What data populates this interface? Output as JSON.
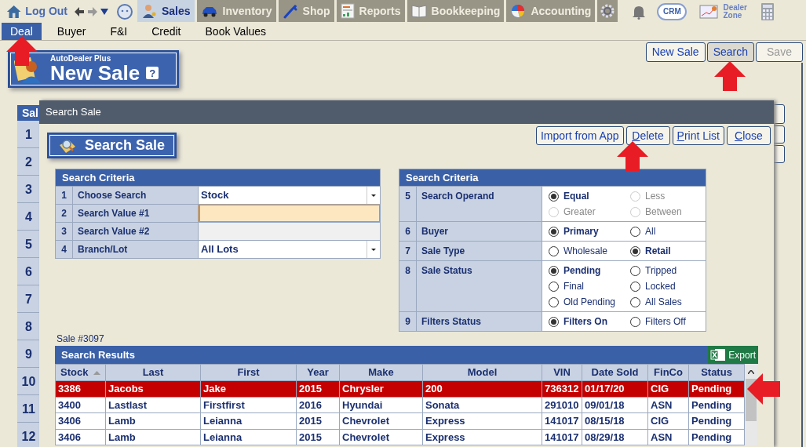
{
  "top_bar": {
    "logout": "Log Out",
    "tabs": [
      {
        "label": "Sales",
        "selected": true
      },
      {
        "label": "Inventory",
        "selected": false
      },
      {
        "label": "Shop",
        "selected": false
      },
      {
        "label": "Reports",
        "selected": false
      },
      {
        "label": "Bookkeeping",
        "selected": false
      },
      {
        "label": "Accounting",
        "selected": false
      }
    ],
    "crm": "CRM",
    "dealer_zone": [
      "Dealer",
      "Zone"
    ]
  },
  "sub_tabs": [
    {
      "label": "Deal",
      "selected": true
    },
    {
      "label": "Buyer",
      "selected": false
    },
    {
      "label": "F&I",
      "selected": false
    },
    {
      "label": "Credit",
      "selected": false
    },
    {
      "label": "Book Values",
      "selected": false
    }
  ],
  "banner": {
    "brand": "AutoDealer Plus",
    "title": "New Sale",
    "help": "?"
  },
  "actions": [
    {
      "label": "New Sale",
      "pressed": false,
      "disabled": false
    },
    {
      "label": "Search",
      "pressed": true,
      "disabled": false
    },
    {
      "label": "Save",
      "pressed": false,
      "disabled": true
    }
  ],
  "background_list": {
    "header": "Sal",
    "rows": [
      "1",
      "2",
      "3",
      "4",
      "5",
      "6",
      "7",
      "8",
      "9",
      "10",
      "11",
      "12"
    ]
  },
  "dialog": {
    "title": "Search Sale",
    "banner": "Search Sale",
    "buttons": [
      {
        "label": "Import from App",
        "underline_first": false
      },
      {
        "label": "Delete",
        "underline_first": true
      },
      {
        "label": "Print List",
        "underline_first": true
      },
      {
        "label": "Close",
        "underline_first": true
      }
    ],
    "criteria_left": {
      "title": "Search Criteria",
      "rows": [
        {
          "number": "1",
          "label": "Choose Search",
          "kind": "select",
          "value": "Stock"
        },
        {
          "number": "2",
          "label": "Search Value #1",
          "kind": "input",
          "focused": true,
          "disabled": false
        },
        {
          "number": "3",
          "label": "Search Value #2",
          "kind": "input",
          "focused": false,
          "disabled": true
        },
        {
          "number": "4",
          "label": "Branch/Lot",
          "kind": "select",
          "value": "All Lots"
        }
      ]
    },
    "criteria_right": {
      "title": "Search Criteria",
      "rows": [
        {
          "number": "5",
          "label": "Search Operand",
          "options": [
            {
              "label": "Equal",
              "selected": true,
              "disabled": false
            },
            {
              "label": "Less",
              "selected": false,
              "disabled": true
            },
            {
              "label": "Greater",
              "selected": false,
              "disabled": true
            },
            {
              "label": "Between",
              "selected": false,
              "disabled": true
            }
          ]
        },
        {
          "number": "6",
          "label": "Buyer",
          "options": [
            {
              "label": "Primary",
              "selected": true,
              "disabled": false
            },
            {
              "label": "All",
              "selected": false,
              "disabled": false
            }
          ]
        },
        {
          "number": "7",
          "label": "Sale Type",
          "options": [
            {
              "label": "Wholesale",
              "selected": false,
              "disabled": false
            },
            {
              "label": "Retail",
              "selected": true,
              "disabled": false
            }
          ]
        },
        {
          "number": "8",
          "label": "Sale Status",
          "options": [
            {
              "label": "Pending",
              "selected": true,
              "disabled": false
            },
            {
              "label": "Tripped",
              "selected": false,
              "disabled": false
            },
            {
              "label": "Final",
              "selected": false,
              "disabled": false
            },
            {
              "label": "Locked",
              "selected": false,
              "disabled": false
            },
            {
              "label": "Old Pending",
              "selected": false,
              "disabled": false
            },
            {
              "label": "All Sales",
              "selected": false,
              "disabled": false
            }
          ]
        },
        {
          "number": "9",
          "label": "Filters Status",
          "options": [
            {
              "label": "Filters On",
              "selected": true,
              "disabled": false
            },
            {
              "label": "Filters Off",
              "selected": false,
              "disabled": false
            }
          ]
        }
      ]
    },
    "sale_number": "Sale #3097",
    "results": {
      "title": "Search Results",
      "export": "Export",
      "columns": [
        {
          "label": "Stock",
          "sorted": true
        },
        {
          "label": "Last",
          "sorted": false
        },
        {
          "label": "First",
          "sorted": false
        },
        {
          "label": "Year",
          "sorted": false
        },
        {
          "label": "Make",
          "sorted": false
        },
        {
          "label": "Model",
          "sorted": false
        },
        {
          "label": "VIN",
          "sorted": false
        },
        {
          "label": "Date Sold",
          "sorted": false
        },
        {
          "label": "FinCo",
          "sorted": false
        },
        {
          "label": "Status",
          "sorted": false
        }
      ],
      "rows": [
        {
          "selected": true,
          "cells": [
            "3386",
            "Jacobs",
            "Jake",
            "2015",
            "Chrysler",
            "200",
            "736312",
            "01/17/20",
            "CIG",
            "Pending"
          ]
        },
        {
          "selected": false,
          "cells": [
            "3400",
            "Lastlast",
            "Firstfirst",
            "2016",
            "Hyundai",
            "Sonata",
            "291010",
            "09/01/18",
            "ASN",
            "Pending"
          ]
        },
        {
          "selected": false,
          "cells": [
            "3406",
            "Lamb",
            "Leianna",
            "2015",
            "Chevrolet",
            "Express",
            "141017",
            "08/15/18",
            "CIG",
            "Pending"
          ]
        },
        {
          "selected": false,
          "cells": [
            "3406",
            "Lamb",
            "Leianna",
            "2015",
            "Chevrolet",
            "Express",
            "141017",
            "08/29/18",
            "ASN",
            "Pending"
          ]
        }
      ]
    }
  }
}
